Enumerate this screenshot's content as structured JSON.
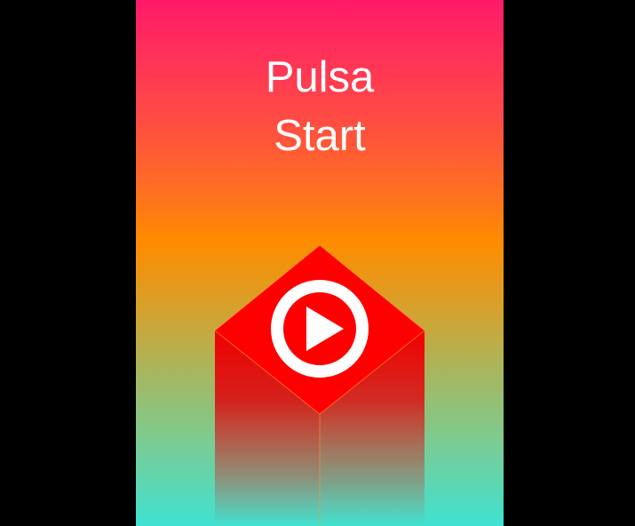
{
  "game": {
    "title_line1": "Pulsa",
    "title_line2": "Start",
    "start_button": {
      "icon": "play-icon",
      "colors": {
        "top_face": "#ff0000",
        "side_face": "#e60000",
        "icon": "#ffffff"
      }
    },
    "background": {
      "top_color": "#ff1a6a",
      "mid_color": "#ff8c00",
      "bottom_color": "#3fe2d2"
    }
  }
}
